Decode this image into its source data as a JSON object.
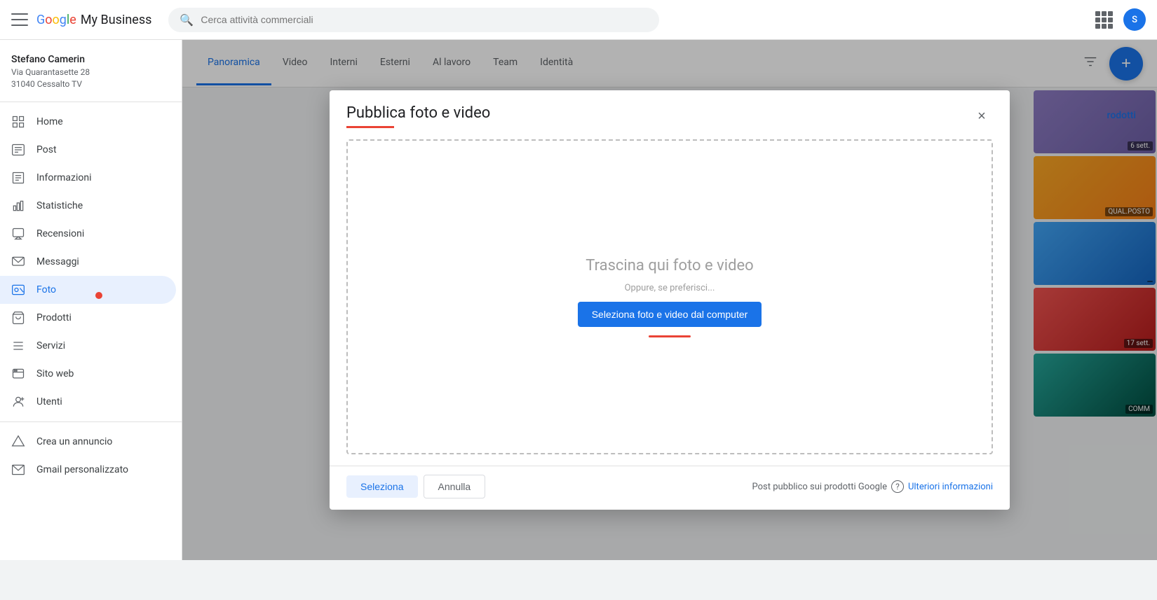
{
  "app": {
    "title": "Google My Business",
    "logo_google": "Google",
    "logo_mybiz": " My Business"
  },
  "topbar": {
    "search_placeholder": "Cerca attività commerciali",
    "menu_label": "Menu"
  },
  "sidebar": {
    "user": {
      "name": "Stefano Camerin",
      "address_line1": "Via Quarantasette 28",
      "address_line2": "31040 Cessalto TV"
    },
    "nav_items": [
      {
        "id": "home",
        "label": "Home",
        "icon": "⊞"
      },
      {
        "id": "post",
        "label": "Post",
        "icon": "▬"
      },
      {
        "id": "informazioni",
        "label": "Informazioni",
        "icon": "☰"
      },
      {
        "id": "statistiche",
        "label": "Statistiche",
        "icon": "▐"
      },
      {
        "id": "recensioni",
        "label": "Recensioni",
        "icon": "⊡"
      },
      {
        "id": "messaggi",
        "label": "Messaggi",
        "icon": "▭"
      },
      {
        "id": "foto",
        "label": "Foto",
        "icon": "⊠",
        "active": true,
        "badge": true
      },
      {
        "id": "prodotti",
        "label": "Prodotti",
        "icon": "◻"
      },
      {
        "id": "servizi",
        "label": "Servizi",
        "icon": "≡"
      },
      {
        "id": "sito-web",
        "label": "Sito web",
        "icon": "⊟"
      },
      {
        "id": "utenti",
        "label": "Utenti",
        "icon": "⊕"
      }
    ],
    "bottom_items": [
      {
        "id": "crea-annuncio",
        "label": "Crea un annuncio",
        "icon": "▲"
      },
      {
        "id": "gmail",
        "label": "Gmail personalizzato",
        "icon": "✉"
      }
    ]
  },
  "tabs": {
    "items": [
      {
        "id": "panoramica",
        "label": "Panoramica",
        "active": true
      },
      {
        "id": "video",
        "label": "Video",
        "active": false
      },
      {
        "id": "interni",
        "label": "Interni",
        "active": false
      },
      {
        "id": "esterni",
        "label": "Esterni",
        "active": false
      },
      {
        "id": "al-lavoro",
        "label": "Al lavoro",
        "active": false
      },
      {
        "id": "team",
        "label": "Team",
        "active": false
      },
      {
        "id": "identita",
        "label": "Identità",
        "active": false
      }
    ],
    "add_button_label": "+"
  },
  "background": {
    "products_label": "rodotti",
    "photos": [
      {
        "id": "p1",
        "label": "6 sett.",
        "color_class": "bg-photo-1"
      },
      {
        "id": "p2",
        "label": "QUAL.POSTO",
        "color_class": "bg-photo-2"
      },
      {
        "id": "p3",
        "label": "",
        "color_class": "bg-photo-3"
      },
      {
        "id": "p4",
        "label": "17 sett.",
        "color_class": "bg-photo-4"
      },
      {
        "id": "p5",
        "label": "COMM",
        "color_class": "bg-photo-5"
      }
    ]
  },
  "modal": {
    "title": "Pubblica foto e video",
    "close_label": "×",
    "drop_text": "Trascina qui foto e video",
    "drop_or": "Oppure, se preferisci...",
    "select_file_btn": "Seleziona foto e video dal computer",
    "footer": {
      "seleziona_label": "Seleziona",
      "annulla_label": "Annulla",
      "info_text": "Post pubblico sui prodotti Google",
      "info_link": "Ulteriori informazioni"
    }
  }
}
